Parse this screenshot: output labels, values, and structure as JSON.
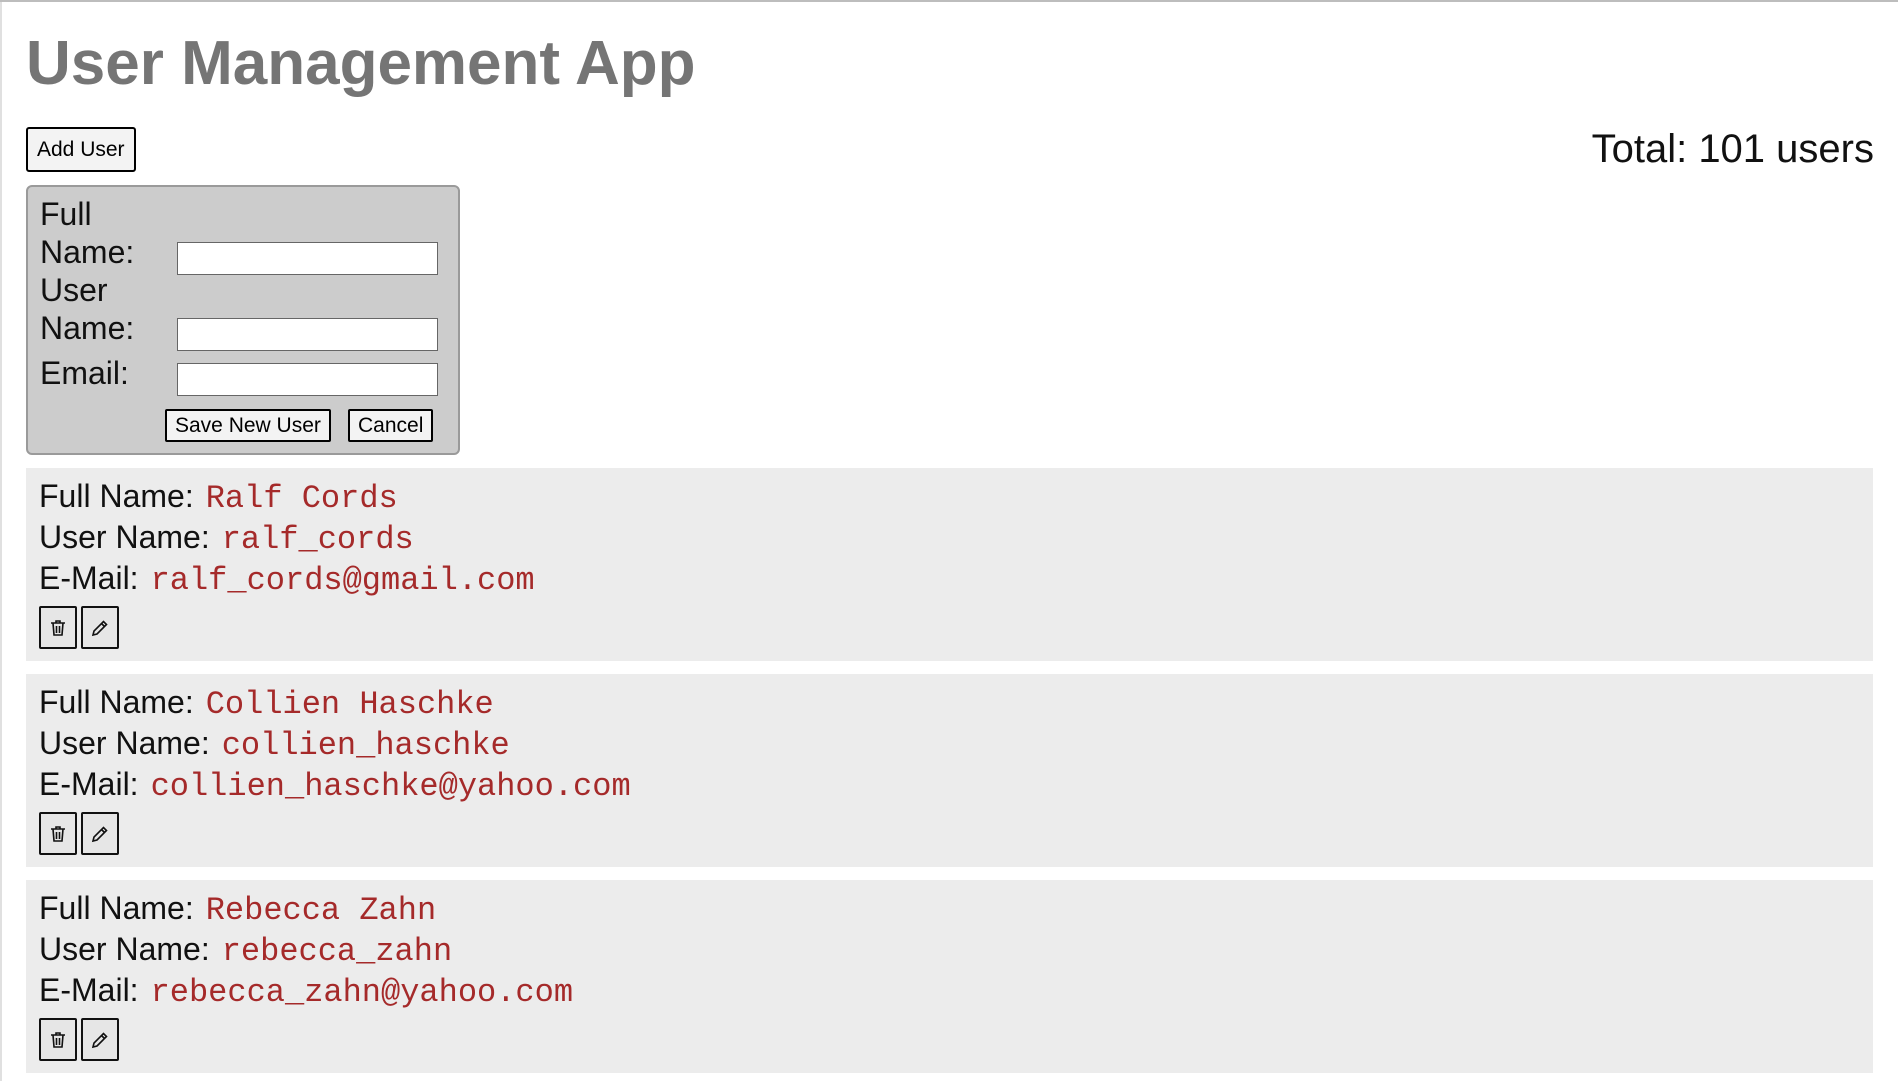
{
  "app": {
    "title": "User Management App",
    "total_prefix": "Total: ",
    "total_count": "101",
    "total_suffix": " users"
  },
  "toolbar": {
    "add_user_label": "Add User"
  },
  "form": {
    "full_name_label": "Full Name:",
    "user_name_label": "User Name:",
    "email_label": "Email:",
    "full_name_value": "",
    "user_name_value": "",
    "email_value": "",
    "save_label": "Save New User",
    "cancel_label": "Cancel"
  },
  "labels": {
    "full_name": "Full Name:",
    "user_name": "User Name:",
    "email": "E-Mail:"
  },
  "users": [
    {
      "full_name": "Ralf Cords",
      "user_name": "ralf_cords",
      "email": "ralf_cords@gmail.com"
    },
    {
      "full_name": "Collien Haschke",
      "user_name": "collien_haschke",
      "email": "collien_haschke@yahoo.com"
    },
    {
      "full_name": "Rebecca Zahn",
      "user_name": "rebecca_zahn",
      "email": "rebecca_zahn@yahoo.com"
    }
  ],
  "icons": {
    "delete": "trash-icon",
    "edit": "pencil-icon"
  },
  "colors": {
    "title": "#757575",
    "value_text": "#a52a2a",
    "form_panel": "#cccccc",
    "card_background": "#ececec"
  }
}
